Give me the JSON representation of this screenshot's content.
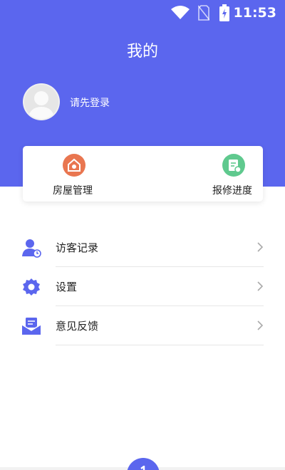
{
  "status_bar": {
    "time": "11:53",
    "icons": [
      "wifi-icon",
      "no-sim-icon",
      "battery-charging-icon"
    ]
  },
  "header": {
    "title": "我的",
    "background": "#5b66ee"
  },
  "profile": {
    "login_prompt": "请先登录"
  },
  "quick_actions": [
    {
      "label": "房屋管理",
      "icon": "house-icon",
      "color": "#e97650"
    },
    {
      "label": "报修进度",
      "icon": "repair-doc-icon",
      "color": "#5fc98e"
    }
  ],
  "menu": [
    {
      "label": "访客记录",
      "icon": "visitor-icon"
    },
    {
      "label": "设置",
      "icon": "settings-gear-icon"
    },
    {
      "label": "意见反馈",
      "icon": "feedback-mail-icon"
    }
  ],
  "accent_color": "#5b66ee"
}
